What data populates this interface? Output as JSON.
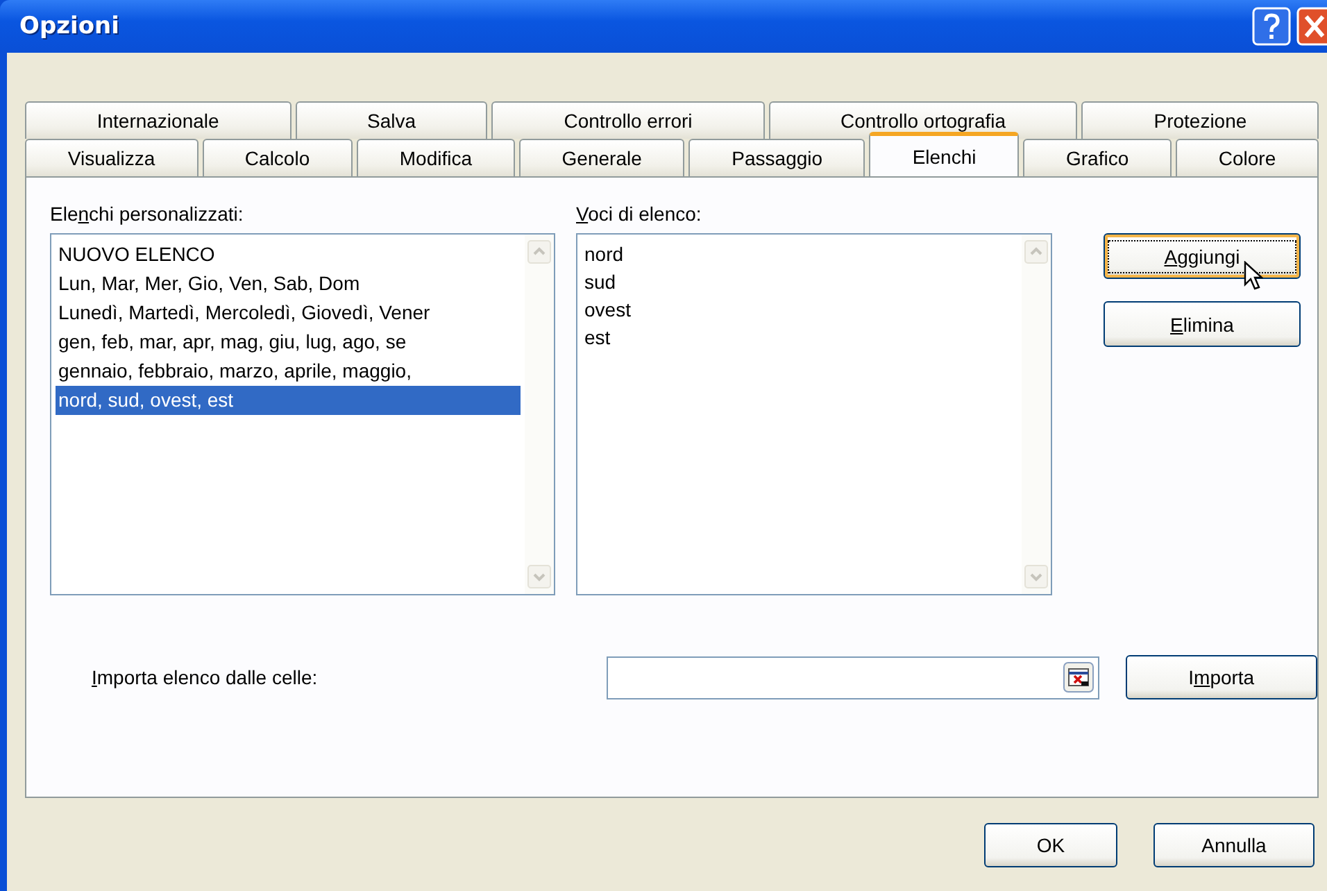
{
  "window": {
    "title": "Opzioni"
  },
  "tab_rows": [
    [
      {
        "label": "Internazionale",
        "selected": false
      },
      {
        "label": "Salva",
        "selected": false
      },
      {
        "label": "Controllo errori",
        "selected": false
      },
      {
        "label": "Controllo ortografia",
        "selected": false
      },
      {
        "label": "Protezione",
        "selected": false
      }
    ],
    [
      {
        "label": "Visualizza",
        "selected": false
      },
      {
        "label": "Calcolo",
        "selected": false
      },
      {
        "label": "Modifica",
        "selected": false
      },
      {
        "label": "Generale",
        "selected": false
      },
      {
        "label": "Passaggio",
        "selected": false
      },
      {
        "label": "Elenchi",
        "selected": true
      },
      {
        "label": "Grafico",
        "selected": false
      },
      {
        "label": "Colore",
        "selected": false
      }
    ]
  ],
  "custom_lists": {
    "label": {
      "pre": "Ele",
      "key": "n",
      "post": "chi personalizzati:"
    },
    "items": [
      {
        "text": "NUOVO ELENCO",
        "selected": false
      },
      {
        "text": "Lun, Mar, Mer, Gio, Ven, Sab, Dom",
        "selected": false
      },
      {
        "text": "Lunedì, Martedì, Mercoledì, Giovedì, Vener",
        "selected": false
      },
      {
        "text": "gen, feb, mar, apr, mag, giu, lug, ago, se",
        "selected": false
      },
      {
        "text": "gennaio, febbraio, marzo, aprile, maggio,",
        "selected": false
      },
      {
        "text": "nord, sud, ovest, est",
        "selected": true
      }
    ]
  },
  "list_entries": {
    "label": {
      "key": "V",
      "post": "oci di elenco:"
    },
    "lines": [
      "nord",
      "sud",
      "ovest",
      "est"
    ]
  },
  "side_buttons": [
    {
      "label": {
        "key": "A",
        "post": "ggiungi"
      },
      "focused": true
    },
    {
      "label": {
        "key": "E",
        "post": "limina"
      },
      "focused": false
    }
  ],
  "import": {
    "label": {
      "key": "I",
      "post": "mporta elenco dalle celle:"
    },
    "button": {
      "label": {
        "pre": "I",
        "key": "m",
        "post": "porta"
      },
      "focused": false
    }
  },
  "footer_buttons": [
    {
      "label": "OK"
    },
    {
      "label": "Annulla"
    }
  ]
}
